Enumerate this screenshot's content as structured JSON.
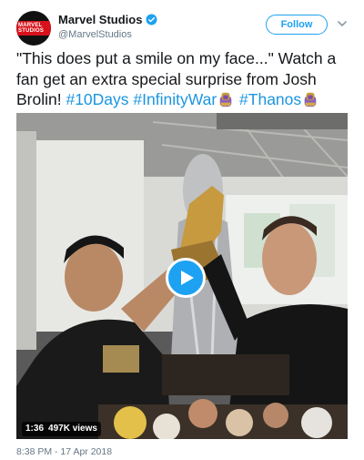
{
  "account": {
    "display_name": "Marvel Studios",
    "handle": "@MarvelStudios",
    "avatar_text": "MARVEL STUDIOS",
    "verified_icon": "verified-badge-icon"
  },
  "actions": {
    "follow_label": "Follow",
    "more_icon": "chevron-down-icon"
  },
  "tweet": {
    "text_part1": "\"This does put a smile on my face...\" Watch a fan get an extra special surprise from Josh Brolin! ",
    "hashtag1": "#10Days",
    "hashtag2": "#InfinityWar",
    "hashtag3": "#Thanos",
    "hashflag_icon": "thanos-hashflag-icon"
  },
  "media": {
    "type": "video",
    "play_icon": "play-icon",
    "duration": "1:36",
    "views": "497K views"
  },
  "timestamp": "8:38 PM - 17 Apr 2018",
  "colors": {
    "accent": "#1da1f2",
    "hashtag": "#1b95e0",
    "muted": "#657786"
  }
}
